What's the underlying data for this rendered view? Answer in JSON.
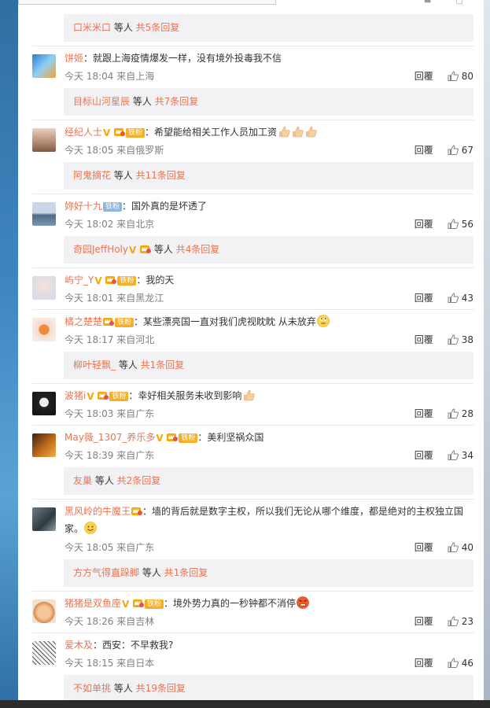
{
  "subs": [
    {
      "user": "口米米口",
      "suffix": " 等人 ",
      "more": "共5条回复"
    },
    {
      "user": "目标山河星辰",
      "suffix": " 等人 ",
      "more": "共7条回复"
    },
    {
      "user": "阿鬼摘花",
      "suffix": " 等人 ",
      "more": "共11条回复"
    },
    {
      "user": "奇园JeffHoly",
      "suffix": " 等人 ",
      "more": "共4条回复"
    },
    {
      "user": "柳叶轻飘_",
      "suffix": " 等人 ",
      "more": "共1条回复"
    },
    {
      "user": "友巢",
      "suffix": " 等人 ",
      "more": "共2条回复"
    },
    {
      "user": "方方气得直跺脚",
      "suffix": " 等人 ",
      "more": "共1条回复"
    },
    {
      "user": "不如单挑",
      "suffix": " 等人 ",
      "more": "共19条回复"
    }
  ],
  "fan_label": "铁粉",
  "reply_label": "回覆",
  "comments": [
    {
      "name": "饼姬",
      "text": "：就跟上海疫情爆发一样，没有境外投毒我不信",
      "time": "今天 18:04 来自上海",
      "likes": "80"
    },
    {
      "name": "经纪人士",
      "text": "：希望能给相关工作人员加工资",
      "time": "今天 18:05 来自俄罗斯",
      "likes": "67"
    },
    {
      "name": "妳好十九",
      "text": "：国外真的是坏透了",
      "time": "今天 18:02 来自北京",
      "likes": "56"
    },
    {
      "name": "屿宁_Y",
      "text": "：我的天",
      "time": "今天 18:01 来自黑龙江",
      "likes": "43"
    },
    {
      "name": "橘之楚楚",
      "text": "：某些漂亮国一直对我们虎视眈眈 从未放弃",
      "time": "今天 18:17 来自河北",
      "likes": "38"
    },
    {
      "name": "波猪i",
      "text": "：幸好相关服务未收到影响",
      "time": "今天 18:03 来自广东",
      "likes": "28"
    },
    {
      "name": "May薇_1307_养乐多",
      "text": "：美利坚祸众国",
      "time": "今天 18:39 来自广东",
      "likes": "34"
    },
    {
      "name": "黑风岭的牛魔王",
      "text": "：墙的背后就是数字主权，所以我们无论从哪个维度，都是绝对的主权独立国",
      "text2": "家。",
      "time": "今天 18:05 来自广东",
      "likes": "40"
    },
    {
      "name": "猪猪是双鱼座",
      "text": "：境外势力真的一秒钟都不消停",
      "time": "今天 18:26 来自吉林",
      "likes": "23"
    },
    {
      "name": "爱木及",
      "text": "：西安：不早救我?",
      "time": "今天 18:15 来自日本",
      "likes": "46"
    }
  ]
}
